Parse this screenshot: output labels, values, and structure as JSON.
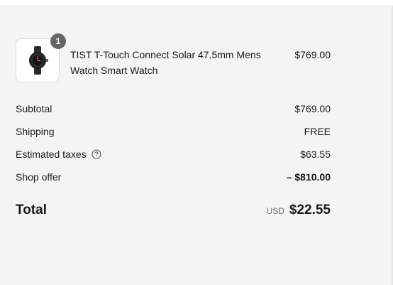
{
  "cart": {
    "items": [
      {
        "quantity": "1",
        "name": "TIST T-Touch Connect Solar 47.5mm Mens Watch Smart Watch",
        "price": "$769.00",
        "image_icon": "watch-icon"
      }
    ]
  },
  "summary": {
    "subtotal_label": "Subtotal",
    "subtotal_value": "$769.00",
    "shipping_label": "Shipping",
    "shipping_value": "FREE",
    "taxes_label": "Estimated taxes",
    "taxes_value": "$63.55",
    "taxes_help_icon": "question-circle-icon",
    "offer_label": "Shop offer",
    "offer_value": "– $810.00",
    "total_label": "Total",
    "total_currency": "USD",
    "total_value": "$22.55"
  },
  "colors": {
    "panel_background": "#f4f4f4",
    "badge_background": "#666666",
    "text": "#1a1a1a",
    "muted_text": "#707070"
  }
}
